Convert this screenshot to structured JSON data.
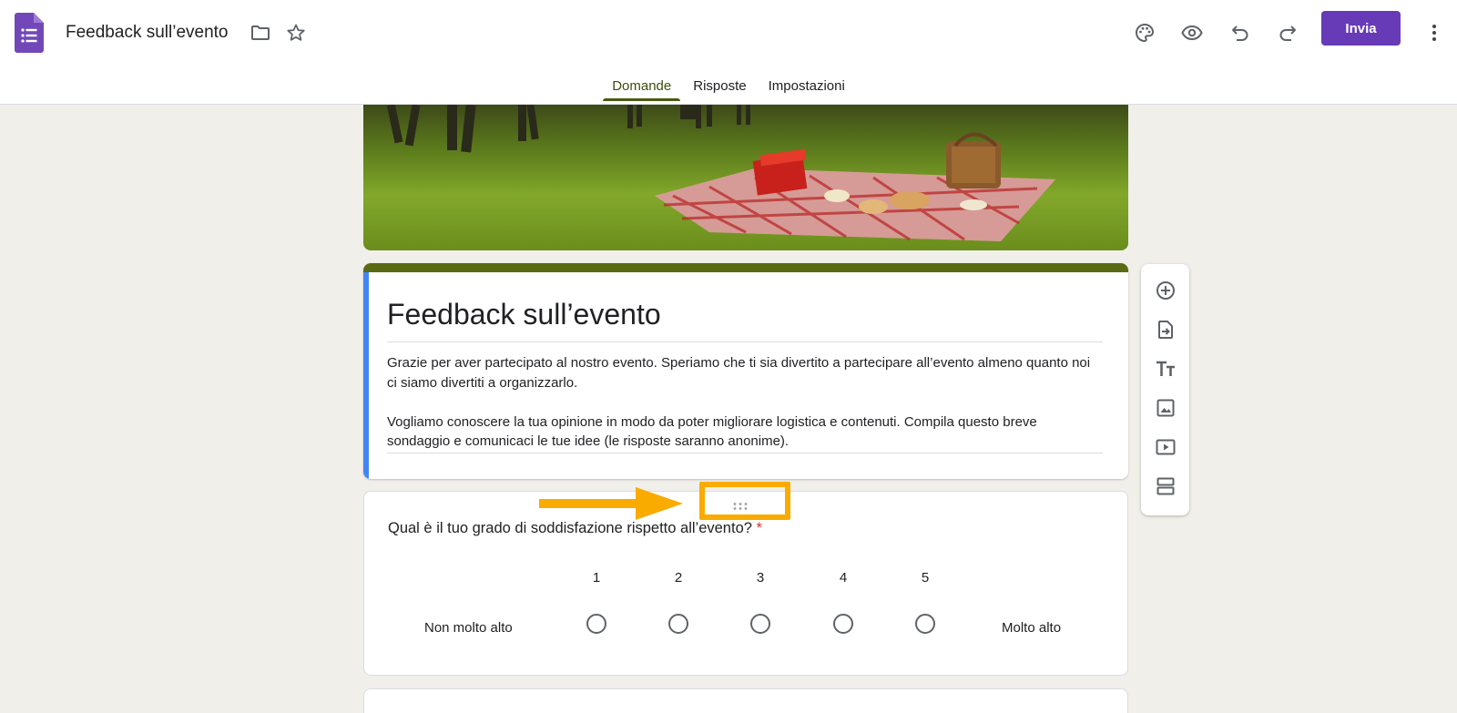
{
  "header": {
    "doc_title": "Feedback sull’evento",
    "send_label": "Invia",
    "icons": [
      "folder-icon",
      "star-icon",
      "palette-icon",
      "eye-icon",
      "undo-icon",
      "redo-icon",
      "more-vert-icon"
    ],
    "accent_color": "#673ab7"
  },
  "tabs": [
    {
      "label": "Domande",
      "active": true
    },
    {
      "label": "Risposte",
      "active": false
    },
    {
      "label": "Impostazioni",
      "active": false
    }
  ],
  "form": {
    "title": "Feedback sull’evento",
    "description_p1": "Grazie per aver partecipato al nostro evento. Speriamo che ti sia divertito a partecipare all’evento almeno quanto noi ci siamo divertiti a organizzarlo.",
    "description_p2": "Vogliamo conoscere la tua opinione in modo da poter migliorare logistica e contenuti. Compila questo breve sondaggio e comunicaci le tue idee (le risposte saranno anonime).",
    "theme_color": "#5a6a12"
  },
  "question": {
    "text": "Qual è il tuo grado di soddisfazione rispetto all’evento?",
    "required_mark": "*",
    "scale": [
      "1",
      "2",
      "3",
      "4",
      "5"
    ],
    "low_label": "Non molto alto",
    "high_label": "Molto alto"
  },
  "side_toolbar": [
    "add-question-icon",
    "import-questions-icon",
    "add-title-icon",
    "add-image-icon",
    "add-video-icon",
    "add-section-icon"
  ],
  "annotation": {
    "highlight_color": "#f9ab00"
  }
}
